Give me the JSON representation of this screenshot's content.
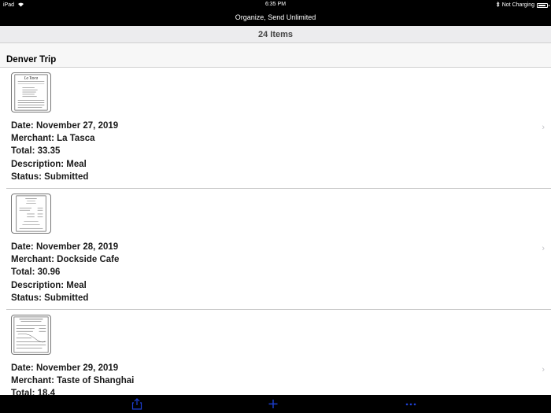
{
  "status_bar": {
    "device": "iPad",
    "time": "6:35 PM",
    "battery_status": "Not Charging",
    "battery_level": 0.9
  },
  "nav_bar": {
    "title": "Organize, Send Unlimited"
  },
  "list_header": {
    "count_label": "24 Items"
  },
  "section": {
    "title": "Denver Trip"
  },
  "receipts": [
    {
      "thumb_icon": "receipt-thumbnail-la-tasca",
      "date": "Date: November 27, 2019",
      "merchant": "Merchant: La Tasca",
      "total": "Total: 33.35",
      "description": "Description: Meal",
      "status": "Status: Submitted"
    },
    {
      "thumb_icon": "receipt-thumbnail-dockside-cafe",
      "date": "Date: November 28, 2019",
      "merchant": "Merchant: Dockside Cafe",
      "total": "Total: 30.96",
      "description": "Description: Meal",
      "status": "Status: Submitted"
    },
    {
      "thumb_icon": "receipt-thumbnail-taste-of-shanghai",
      "date": "Date: November 29, 2019",
      "merchant": "Merchant: Taste of Shanghai",
      "total": "Total: 18.4",
      "description": "",
      "status": ""
    }
  ],
  "tab_bar": {
    "items": [
      {
        "icon": "share-icon"
      },
      {
        "icon": "plus-icon"
      },
      {
        "icon": "more-icon"
      }
    ],
    "accent_color": "#1d3fd1"
  },
  "colors": {
    "bar_background": "#000000",
    "count_bar_background": "#ececee",
    "chevron": "#c4c4c8"
  }
}
